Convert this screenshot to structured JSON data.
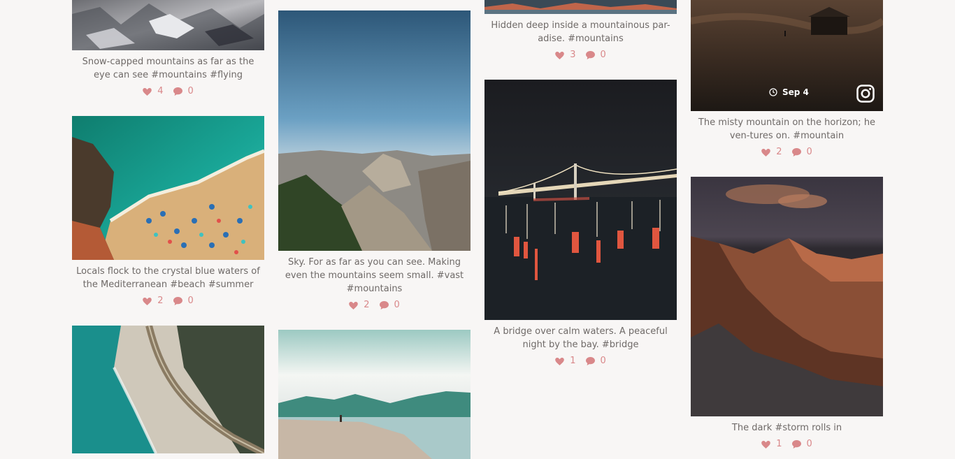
{
  "posts": [
    {
      "caption": "Snow-capped mountains as far as the eye can see #mountains #flying",
      "likes": "4",
      "comments": "0"
    },
    {
      "caption": "Locals flock to the crystal blue waters of the Mediterranean #beach #summer",
      "likes": "2",
      "comments": "0"
    },
    {
      "caption": "Sky. For as far as you can see. Making even the mountains seem small. #vast #mountains",
      "likes": "2",
      "comments": "0"
    },
    {
      "caption": "Hidden deep inside a mountainous par-adise. #mountains",
      "likes": "3",
      "comments": "0"
    },
    {
      "caption": "A bridge over calm waters. A peaceful night by the bay. #bridge",
      "likes": "1",
      "comments": "0"
    },
    {
      "caption": "The misty mountain on the horizon; he ven-tures on. #mountain",
      "likes": "2",
      "comments": "0",
      "date": "Sep 4"
    },
    {
      "caption": "The dark #storm rolls in",
      "likes": "1",
      "comments": "0"
    }
  ],
  "colors": {
    "background": "#f8f6f5",
    "accent": "#d9888a",
    "text": "#6f6a68"
  },
  "icons": {
    "like": "heart-icon",
    "comment": "comment-icon",
    "date": "clock-icon",
    "source": "instagram-icon"
  }
}
